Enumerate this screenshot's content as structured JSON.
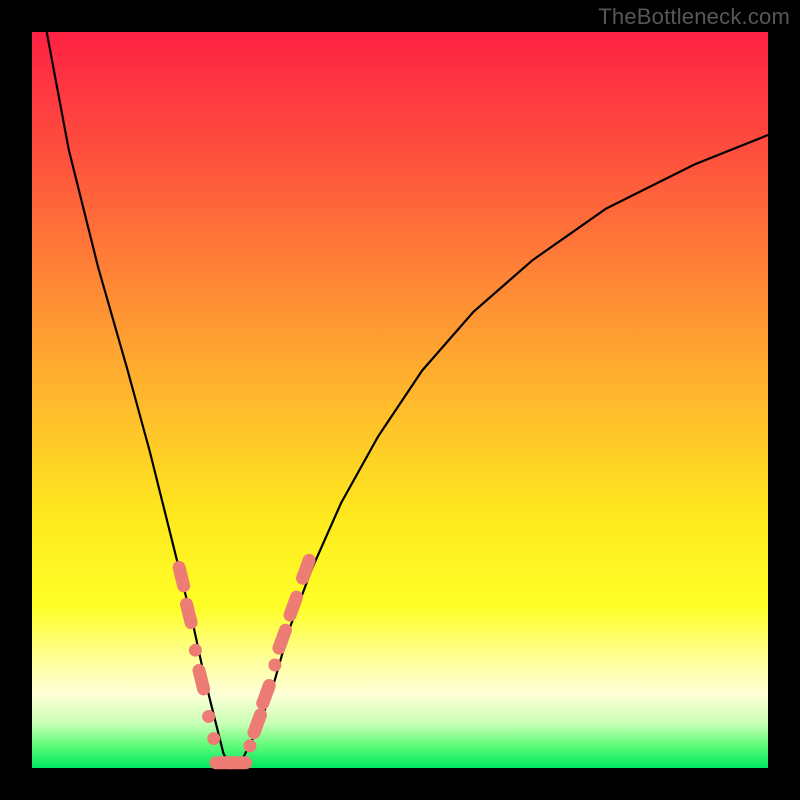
{
  "watermark": "TheBottleneck.com",
  "colors": {
    "frame": "#000000",
    "curve_stroke": "#000000",
    "marker_fill": "#ed7d74",
    "gradient_top": "#fe2244",
    "gradient_bottom": "#00e760"
  },
  "chart_data": {
    "type": "line",
    "title": "",
    "xlabel": "",
    "ylabel": "",
    "xlim": [
      0,
      100
    ],
    "ylim": [
      0,
      100
    ],
    "grid": false,
    "legend": false,
    "series": [
      {
        "name": "bottleneck-curve",
        "x": [
          2,
          5,
          9,
          13,
          16,
          18,
          20,
          22,
          23.5,
          25,
          26,
          27,
          28,
          29,
          31,
          33,
          35,
          38,
          42,
          47,
          53,
          60,
          68,
          78,
          90,
          100
        ],
        "y": [
          100,
          84,
          68,
          54,
          43,
          35,
          27,
          19,
          12,
          6,
          2,
          0,
          0,
          2,
          6,
          12,
          19,
          27,
          36,
          45,
          54,
          62,
          69,
          76,
          82,
          86
        ]
      }
    ],
    "markers": [
      {
        "x": 20.3,
        "y": 26,
        "shape": "pill-d1"
      },
      {
        "x": 21.3,
        "y": 21,
        "shape": "pill-d1"
      },
      {
        "x": 22.2,
        "y": 16,
        "shape": "dot"
      },
      {
        "x": 23.0,
        "y": 12,
        "shape": "pill-d1"
      },
      {
        "x": 24.0,
        "y": 7,
        "shape": "dot"
      },
      {
        "x": 24.7,
        "y": 4,
        "shape": "dot"
      },
      {
        "x": 26.0,
        "y": 0.7,
        "shape": "pill-h"
      },
      {
        "x": 28.0,
        "y": 0.7,
        "shape": "pill-h"
      },
      {
        "x": 29.6,
        "y": 3,
        "shape": "dot"
      },
      {
        "x": 30.6,
        "y": 6,
        "shape": "pill-d2"
      },
      {
        "x": 31.8,
        "y": 10,
        "shape": "pill-d2"
      },
      {
        "x": 33.0,
        "y": 14,
        "shape": "dot"
      },
      {
        "x": 34.0,
        "y": 17.5,
        "shape": "pill-d2"
      },
      {
        "x": 35.5,
        "y": 22,
        "shape": "pill-d2"
      },
      {
        "x": 37.2,
        "y": 27,
        "shape": "pill-d2"
      }
    ]
  }
}
